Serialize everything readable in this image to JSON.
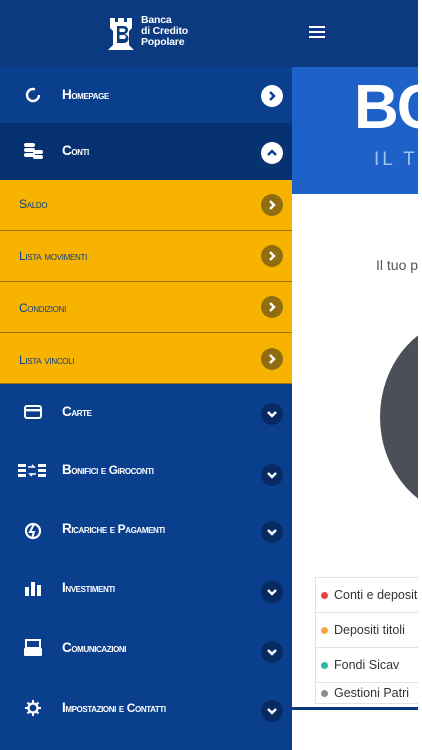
{
  "brand": {
    "line1": "Banca",
    "line2": "di Credito",
    "line3": "Popolare"
  },
  "menu": {
    "items": [
      {
        "label": "Homepage",
        "icon": "refresh-icon",
        "state": "collapsed"
      },
      {
        "label": "Conti",
        "icon": "coins-icon",
        "state": "expanded"
      },
      {
        "label": "Carte",
        "icon": "card-icon",
        "state": "collapsed"
      },
      {
        "label": "Bonifici e Giroconti",
        "icon": "transfer-icon",
        "state": "collapsed"
      },
      {
        "label": "Ricariche e Pagamenti",
        "icon": "recharge-icon",
        "state": "collapsed"
      },
      {
        "label": "Investimenti",
        "icon": "bar-chart-icon",
        "state": "collapsed"
      },
      {
        "label": "Comunicazioni",
        "icon": "printer-icon",
        "state": "collapsed"
      },
      {
        "label": "Impostazioni e Contatti",
        "icon": "gear-icon",
        "state": "collapsed"
      }
    ],
    "conti_subitems": [
      "Saldo",
      "Lista movimenti",
      "Condizioni",
      "Lista vincoli"
    ]
  },
  "content": {
    "hero_title": "BC",
    "hero_subtitle": "IL TU",
    "intro": "Il tuo p",
    "legend": [
      {
        "label": "Conti e deposit",
        "color": "#e84242"
      },
      {
        "label": "Depositi titoli",
        "color": "#f4a742"
      },
      {
        "label": "Fondi Sicav",
        "color": "#2cb7a9"
      },
      {
        "label": "Gestioni Patri",
        "color": "#8a8a8a"
      }
    ]
  },
  "colors": {
    "primary": "#0a3f8e",
    "accent": "#f7b300",
    "hero": "#1e62c9"
  }
}
